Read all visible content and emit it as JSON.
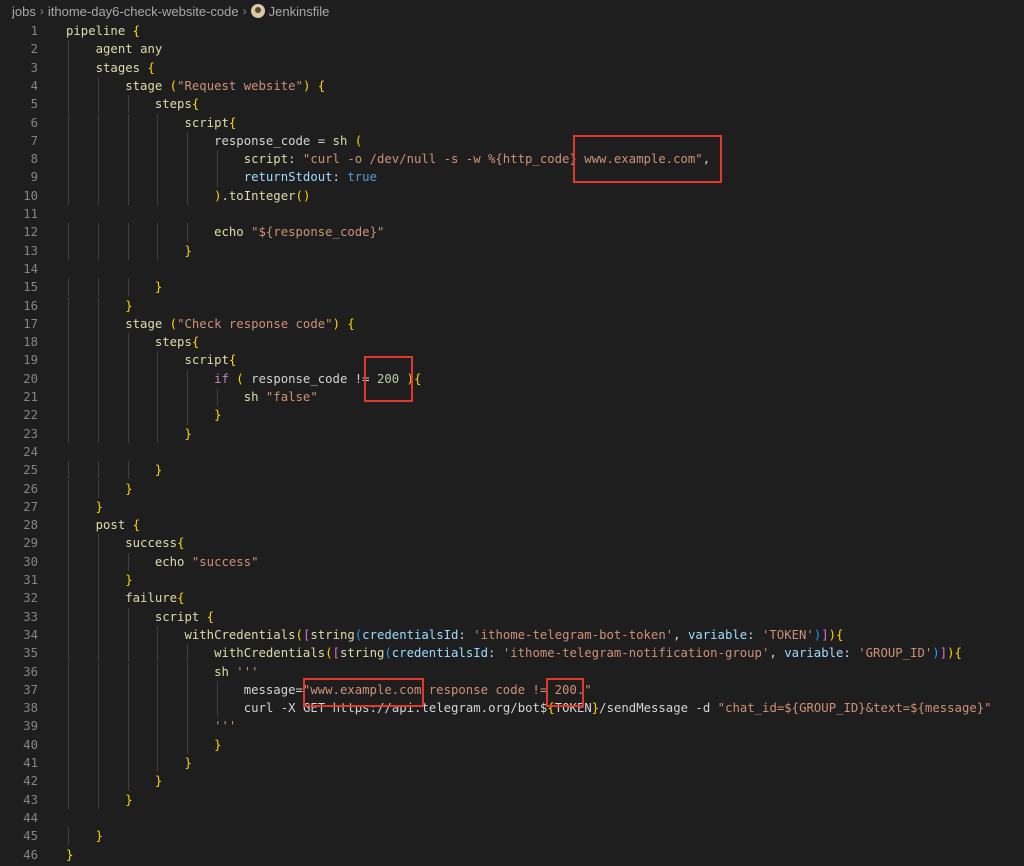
{
  "breadcrumb": {
    "folder": "jobs",
    "subfolder": "ithome-day6-check-website-code",
    "file": "Jenkinsfile"
  },
  "editor": {
    "line_numbers": [
      "1",
      "2",
      "3",
      "4",
      "5",
      "6",
      "7",
      "8",
      "9",
      "10",
      "11",
      "12",
      "13",
      "14",
      "15",
      "16",
      "17",
      "18",
      "19",
      "20",
      "21",
      "22",
      "23",
      "24",
      "25",
      "26",
      "27",
      "28",
      "29",
      "30",
      "31",
      "32",
      "33",
      "34",
      "35",
      "36",
      "37",
      "38",
      "39",
      "40",
      "41",
      "42",
      "43",
      "44",
      "45",
      "46"
    ],
    "lines": [
      "pipeline {",
      "    agent any",
      "    stages {",
      "        stage (\"Request website\") {",
      "            steps{",
      "                script{",
      "                    response_code = sh (",
      "                        script: \"curl -o /dev/null -s -w %{http_code} www.example.com\",",
      "                        returnStdout: true",
      "                    ).toInteger()",
      "",
      "                    echo \"${response_code}\"",
      "                }",
      "",
      "            }",
      "        }",
      "        stage (\"Check response code\") {",
      "            steps{",
      "                script{",
      "                    if ( response_code != 200 ){",
      "                        sh \"false\"",
      "                    }",
      "                }",
      "",
      "            }",
      "        }",
      "    }",
      "    post {",
      "        success{",
      "            echo \"success\"",
      "        }",
      "        failure{",
      "            script {",
      "                withCredentials([string(credentialsId: 'ithome-telegram-bot-token', variable: 'TOKEN')]){",
      "                    withCredentials([string(credentialsId: 'ithome-telegram-notification-group', variable: 'GROUP_ID')]){",
      "                    sh '''",
      "                        message=\"www.example.com response code != 200.\"",
      "                        curl -X GET https://api.telegram.org/bot${TOKEN}/sendMessage -d \"chat_id=${GROUP_ID}&text=${message}\"",
      "                    '''",
      "                    }",
      "                }",
      "            }",
      "        }",
      "",
      "    }",
      "}"
    ]
  },
  "theme": {
    "background": "#1e1e1e",
    "highlight_border": "#e1382b"
  }
}
